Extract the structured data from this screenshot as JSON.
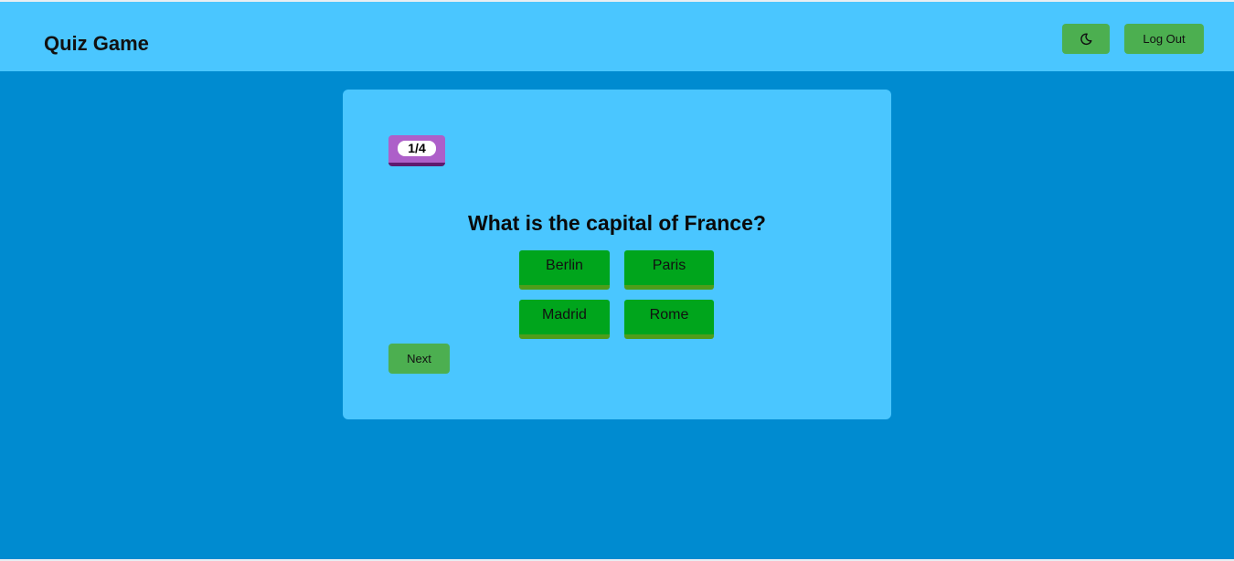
{
  "header": {
    "title": "Quiz Game",
    "theme_toggle_icon": "moon-icon",
    "logout_label": "Log Out"
  },
  "quiz": {
    "progress": "1/4",
    "current_question": 1,
    "total_questions": 4,
    "question": "What is the capital of France?",
    "answers": [
      "Berlin",
      "Paris",
      "Madrid",
      "Rome"
    ],
    "next_label": "Next"
  },
  "colors": {
    "page_background": "#008bd0",
    "header_background": "#4ac6ff",
    "card_background": "#4ac6ff",
    "answer_button": "#00a51c",
    "action_button": "#4caf50",
    "progress_badge": "#ad5fc9"
  }
}
